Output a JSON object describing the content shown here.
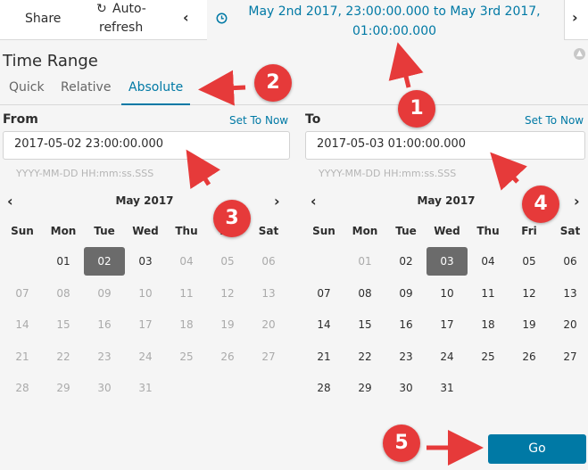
{
  "toolbar": {
    "share_label": "Share",
    "autorefresh_line1": "Auto-",
    "autorefresh_line2": "refresh",
    "range_line1": "May 2nd 2017, 23:00:00.000 to May 3rd 2017,",
    "range_line2": "01:00:00.000"
  },
  "panel": {
    "title": "Time Range",
    "tabs": [
      "Quick",
      "Relative",
      "Absolute"
    ],
    "active_tab": "Absolute"
  },
  "from": {
    "label": "From",
    "set_to_now": "Set To Now",
    "value": "2017-05-02 23:00:00.000",
    "format_hint": "YYYY-MM-DD HH:mm:ss.SSS",
    "month": "May 2017",
    "selected_day": "02"
  },
  "to": {
    "label": "To",
    "set_to_now": "Set To Now",
    "value": "2017-05-03 01:00:00.000",
    "format_hint": "YYYY-MM-DD HH:mm:ss.SSS",
    "month": "May 2017",
    "selected_day": "03"
  },
  "weekdays": [
    "Sun",
    "Mon",
    "Tue",
    "Wed",
    "Thu",
    "Fri",
    "Sat"
  ],
  "go_label": "Go",
  "markers": [
    "1",
    "2",
    "3",
    "4",
    "5"
  ],
  "colors": {
    "accent": "#0079a5",
    "marker": "#e63a3a",
    "selected_day": "#6b6b6b"
  }
}
